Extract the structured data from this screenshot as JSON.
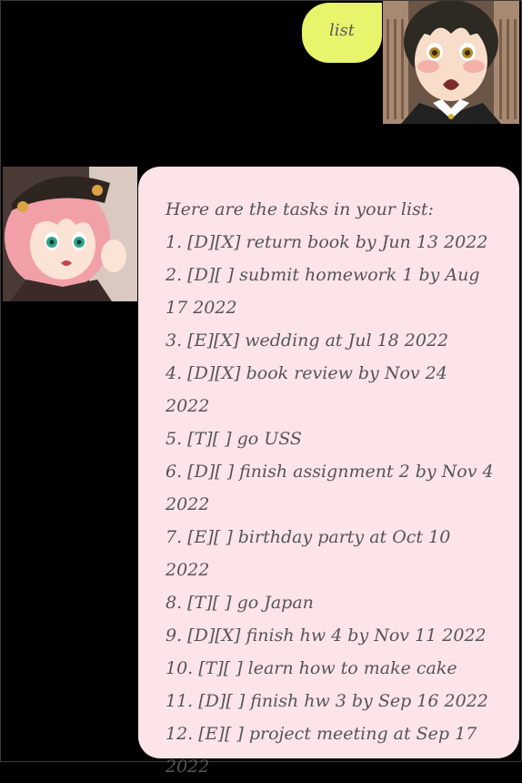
{
  "user_message": {
    "text": "list"
  },
  "bot_message": {
    "intro": "Here are the tasks in your list:",
    "tasks": [
      "1. [D][X] return book by Jun 13 2022",
      "2. [D][ ] submit homework 1 by Aug 17 2022",
      "3. [E][X] wedding at Jul 18 2022",
      "4. [D][X] book review by Nov 24 2022",
      "5. [T][ ] go USS",
      "6. [D][ ] finish assignment 2 by Nov 4 2022",
      "7. [E][ ] birthday party at Oct 10 2022",
      "8. [T][ ] go Japan",
      "9. [D][X] finish hw 4 by Nov 11 2022",
      "10. [T][ ] learn how to make cake",
      "11. [D][ ] finish hw 3 by Sep 16 2022",
      "12. [E][ ] project meeting at Sep 17 2022"
    ]
  },
  "colors": {
    "background": "#000000",
    "user_bubble": "#e7f46c",
    "bot_bubble": "#fde4e8",
    "text": "#555555"
  }
}
